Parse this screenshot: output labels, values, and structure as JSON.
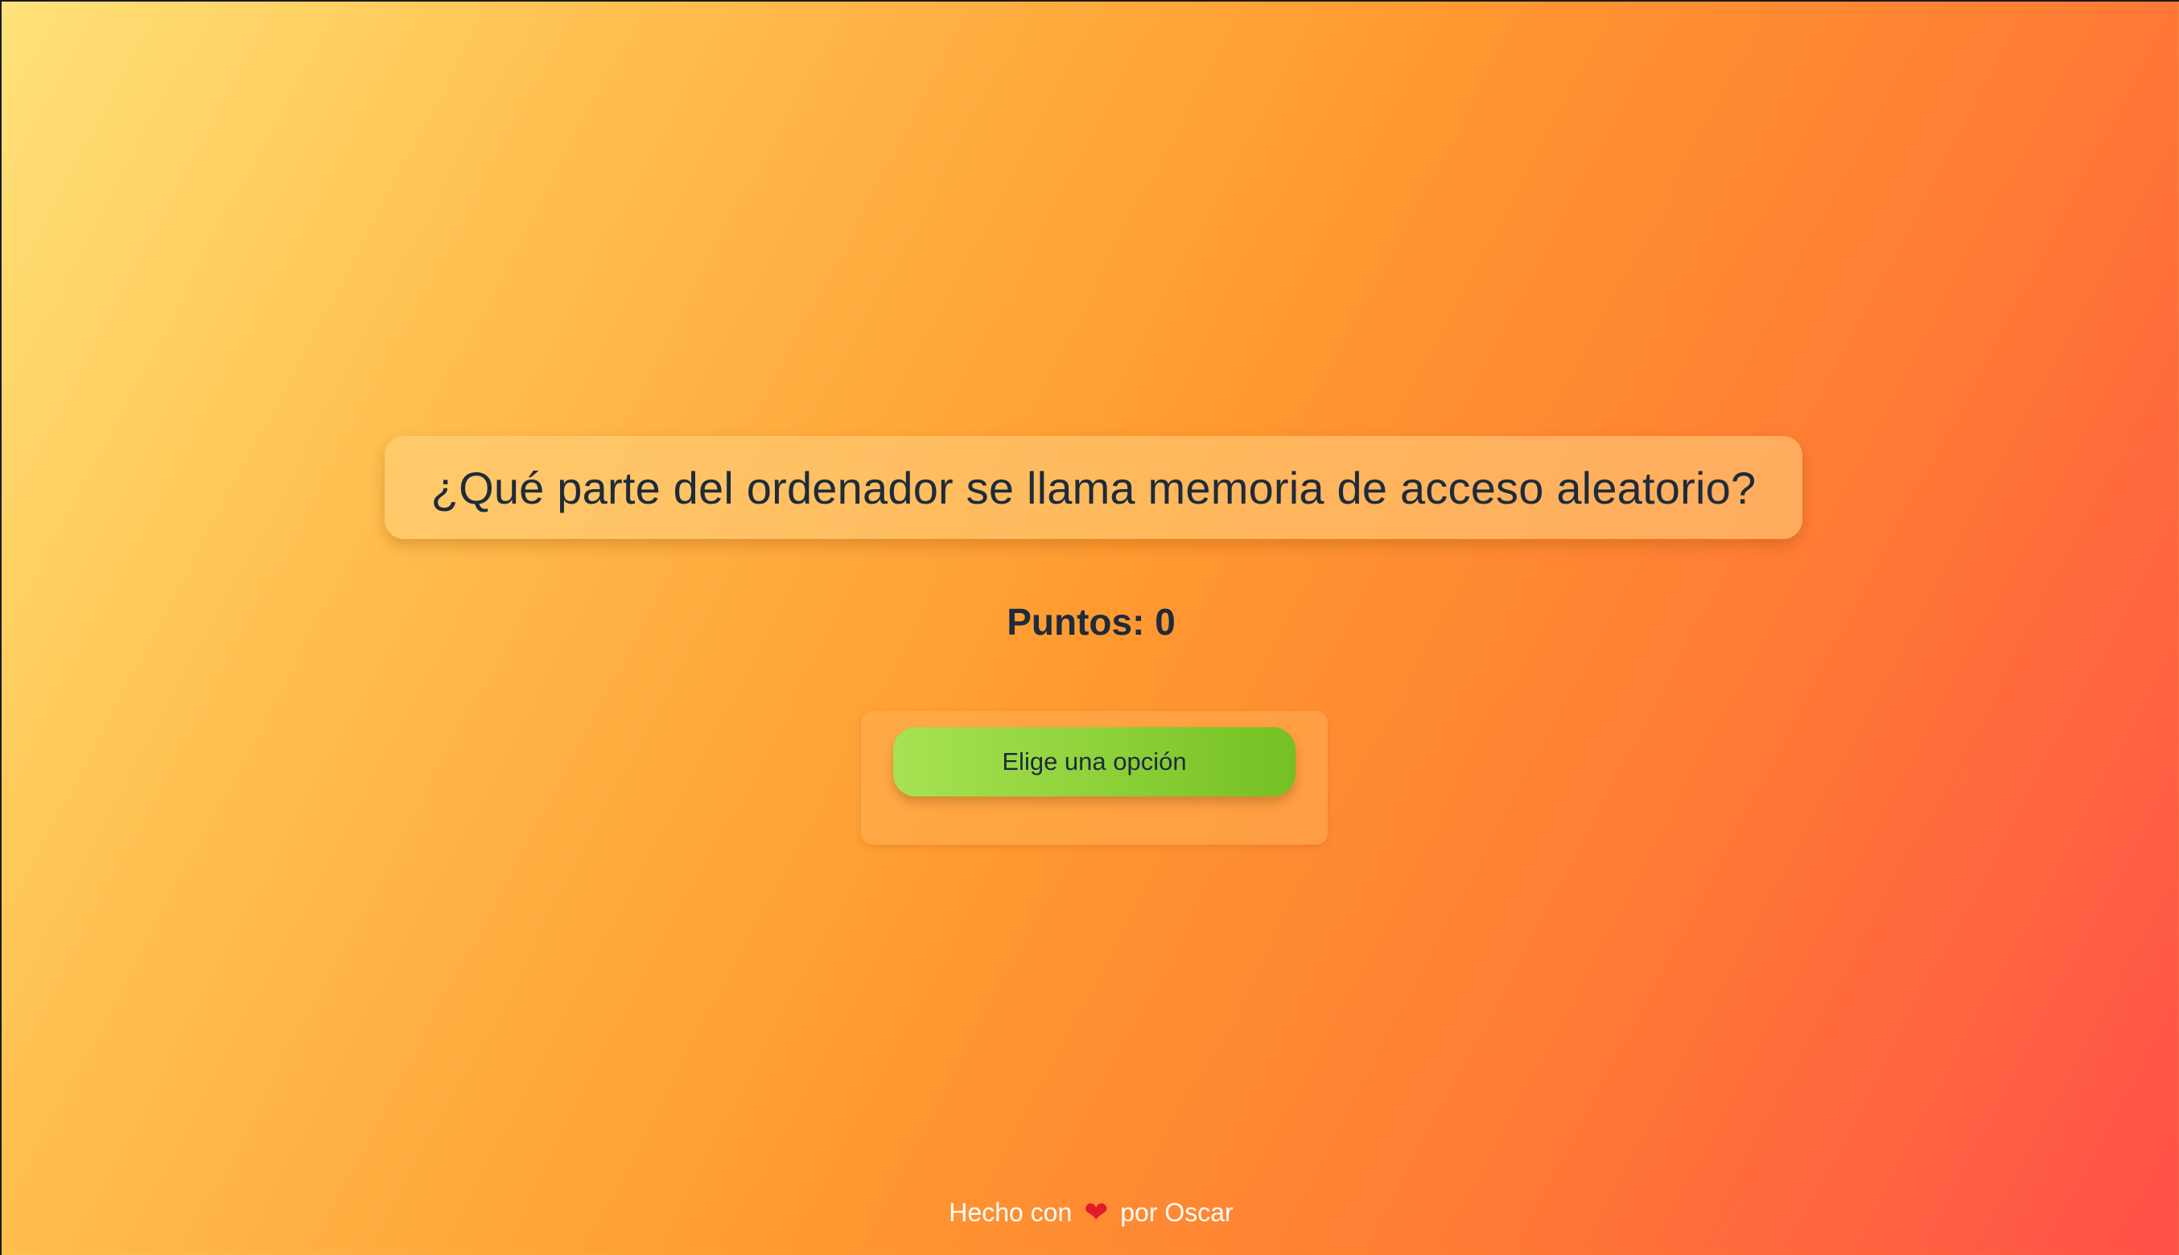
{
  "quiz": {
    "question": "¿Qué parte del ordenador se llama memoria de acceso aleatorio?",
    "score_label": "Puntos: 0",
    "choose_option_label": "Elige una opción"
  },
  "footer": {
    "prefix": "Hecho con",
    "heart_icon": "heart-icon",
    "heart_glyph": "❤",
    "suffix": "por Oscar"
  },
  "colors": {
    "background_gradient": [
      "#ffe27a",
      "#ff9a30",
      "#ff4f4a"
    ],
    "text_dark": "#1d2b3a",
    "button_green": "#8fd23b",
    "heart": "#e21b2c",
    "footer_text": "#ffffff"
  }
}
